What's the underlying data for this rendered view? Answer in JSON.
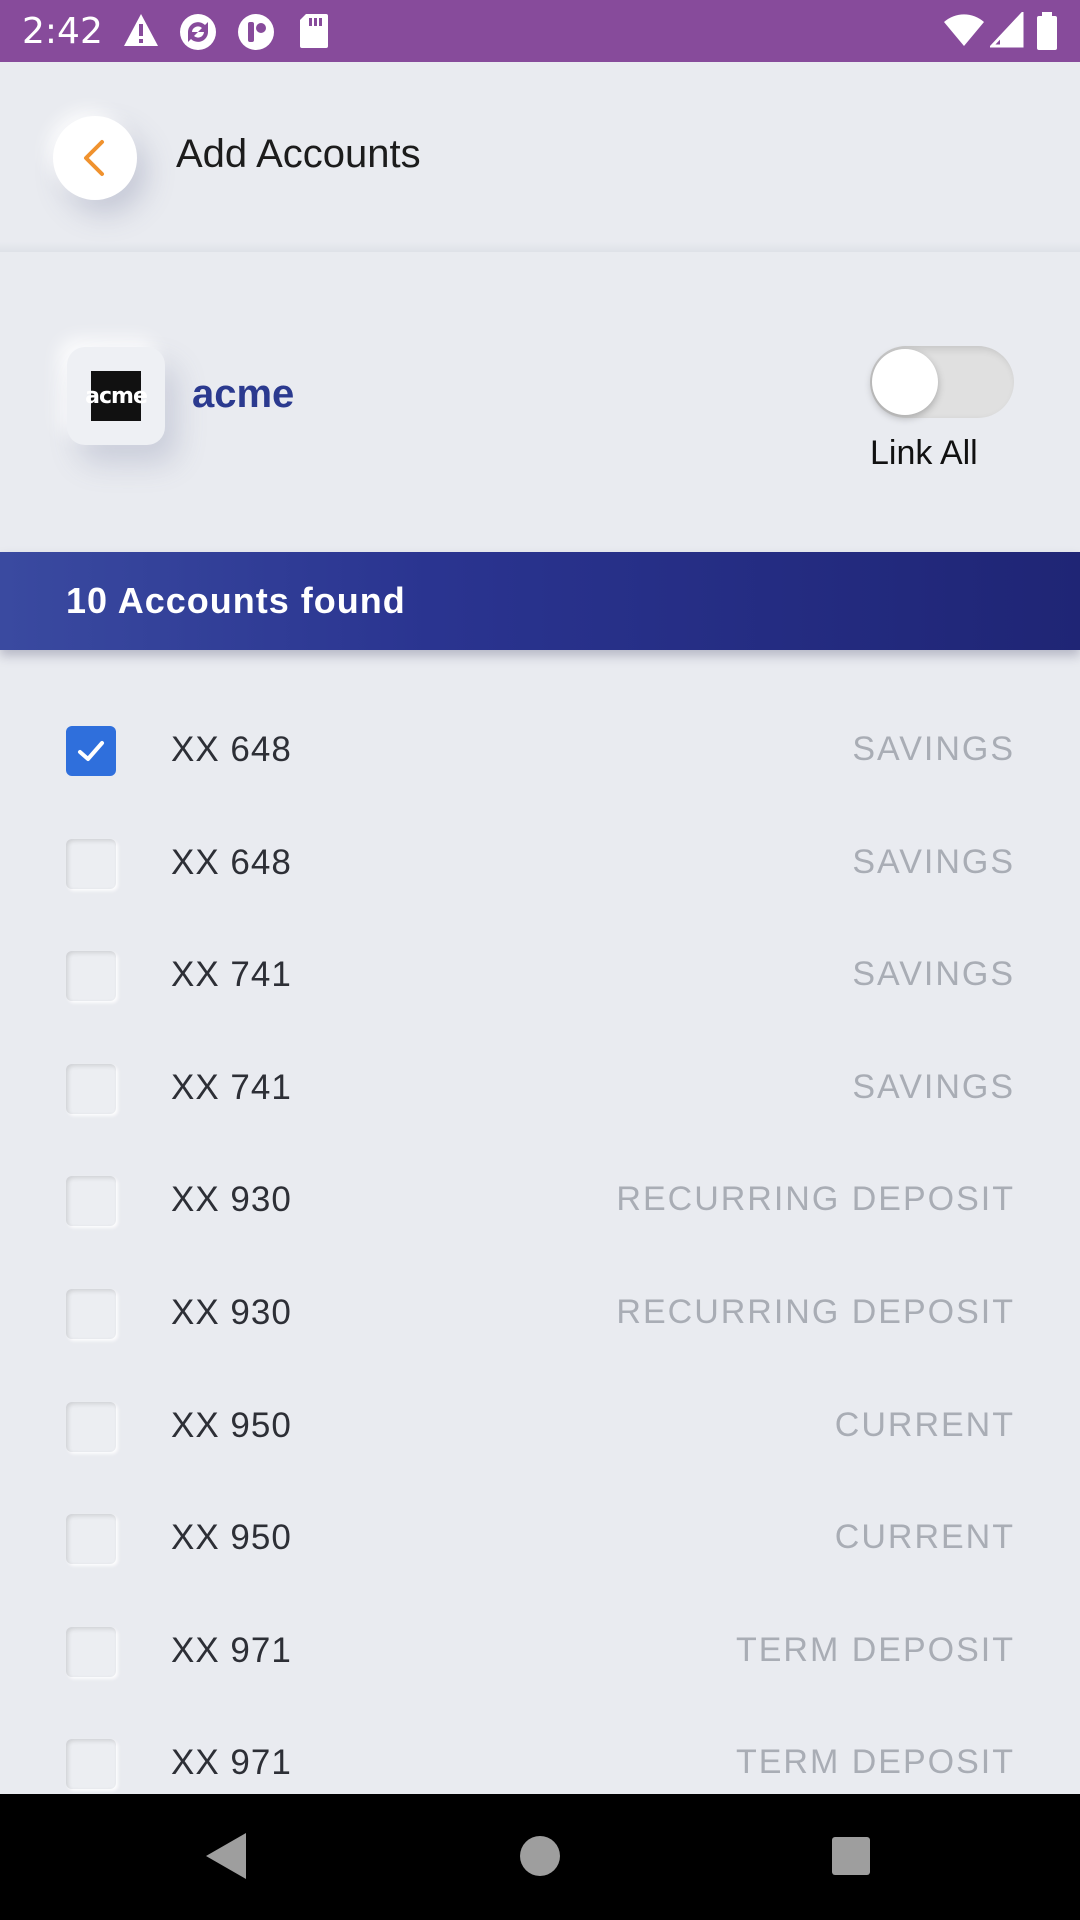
{
  "status_bar": {
    "time": "2:42",
    "left_icons": [
      "warning-icon",
      "sync-icon",
      "vpn-icon",
      "sd-card-icon"
    ],
    "right_icons": [
      "wifi-icon",
      "signal-icon",
      "battery-icon"
    ]
  },
  "header": {
    "title": "Add Accounts",
    "back_icon": "chevron-left-icon",
    "accent_color": "#f0922e"
  },
  "bank": {
    "logo_text": "acme",
    "name": "acme",
    "link_all_label": "Link All",
    "link_all_on": false
  },
  "banner": {
    "text": "10 Accounts found"
  },
  "accounts": [
    {
      "number": "XX 648",
      "type": "SAVINGS",
      "checked": true
    },
    {
      "number": "XX 648",
      "type": "SAVINGS",
      "checked": false
    },
    {
      "number": "XX 741",
      "type": "SAVINGS",
      "checked": false
    },
    {
      "number": "XX 741",
      "type": "SAVINGS",
      "checked": false
    },
    {
      "number": "XX 930",
      "type": "RECURRING DEPOSIT",
      "checked": false
    },
    {
      "number": "XX 930",
      "type": "RECURRING DEPOSIT",
      "checked": false
    },
    {
      "number": "XX 950",
      "type": "CURRENT",
      "checked": false
    },
    {
      "number": "XX 950",
      "type": "CURRENT",
      "checked": false
    },
    {
      "number": "XX 971",
      "type": "TERM DEPOSIT",
      "checked": false
    },
    {
      "number": "XX 971",
      "type": "TERM DEPOSIT",
      "checked": false
    }
  ],
  "nav_bar": {
    "buttons": [
      "back-triangle-icon",
      "home-circle-icon",
      "recents-square-icon"
    ]
  }
}
